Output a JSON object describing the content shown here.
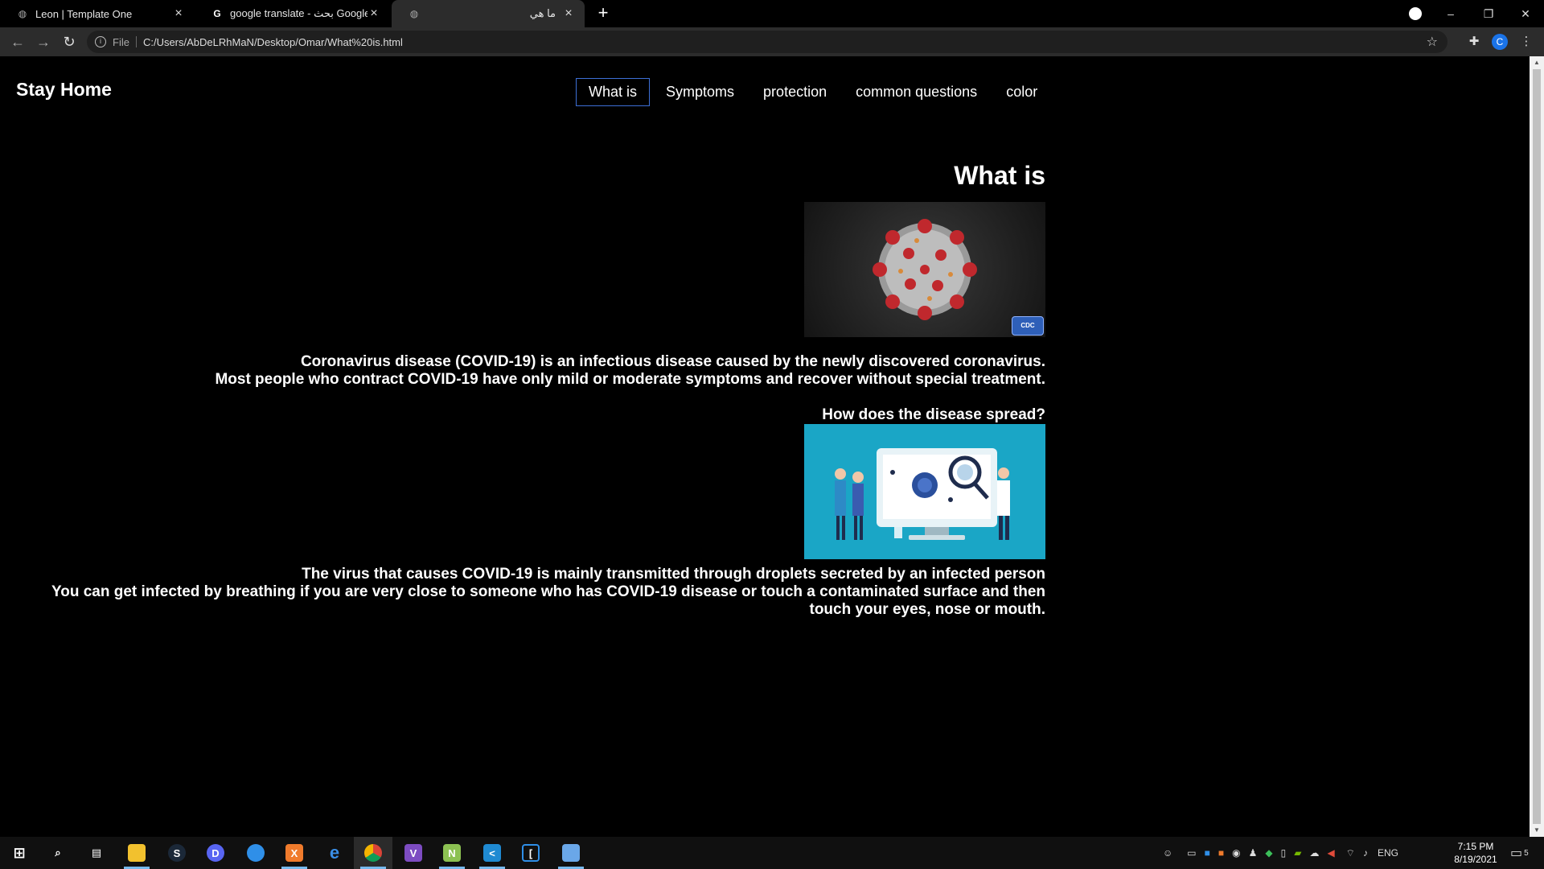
{
  "browser": {
    "tabs": [
      {
        "title": "Leon | Template One",
        "icon": "globe-icon",
        "active": false
      },
      {
        "title": "google translate - بحث Google",
        "icon": "google-icon",
        "active": false
      },
      {
        "title": "ما هي",
        "icon": "globe-icon",
        "active": true
      }
    ],
    "new_tab_symbol": "+",
    "window_controls": {
      "minimize": "–",
      "restore": "❐",
      "close": "✕"
    },
    "address": {
      "scheme": "File",
      "url": "C:/Users/AbDeLRhMaN/Desktop/Omar/What%20is.html"
    },
    "profile_initial": "C"
  },
  "page": {
    "brand": "Stay Home",
    "nav": [
      {
        "label": "What is",
        "current": true
      },
      {
        "label": "Symptoms",
        "current": false
      },
      {
        "label": "protection",
        "current": false
      },
      {
        "label": "common questions",
        "current": false
      },
      {
        "label": "color",
        "current": false
      }
    ],
    "heading": "What is",
    "image1": {
      "alt": "coronavirus-image",
      "badge": "CDC"
    },
    "intro": [
      "Coronavirus disease (COVID-19) is an infectious disease caused by the newly discovered coronavirus.",
      "Most people who contract COVID-19 have only mild or moderate symptoms and recover without special treatment."
    ],
    "spread_heading": "How does the disease spread?",
    "image2": {
      "alt": "virus-research-illustration"
    },
    "spread_text": [
      "The virus that causes COVID-19 is mainly transmitted through droplets secreted by an infected person",
      "You can get infected by breathing if you are very close to someone who has COVID-19 disease or touch a contaminated surface and then touch your eyes, nose or mouth."
    ]
  },
  "taskbar": {
    "apps": [
      "windows-start-icon",
      "search-icon",
      "task-view-icon",
      "file-explorer-icon",
      "steam-icon",
      "discord-icon",
      "app-blue-icon",
      "xampp-icon",
      "edge-icon",
      "chrome-icon",
      "visual-studio-icon",
      "notepad-plus-icon",
      "vscode-icon",
      "app-bracket-icon",
      "app-network-icon"
    ],
    "language": "ENG",
    "time": "7:15 PM",
    "date": "8/19/2021",
    "notifications": "5"
  },
  "colors": {
    "accent": "#3d6fd6",
    "page_bg": "#000000",
    "chrome_bg": "#2c2c2c",
    "taskbar_bg": "#101010"
  }
}
